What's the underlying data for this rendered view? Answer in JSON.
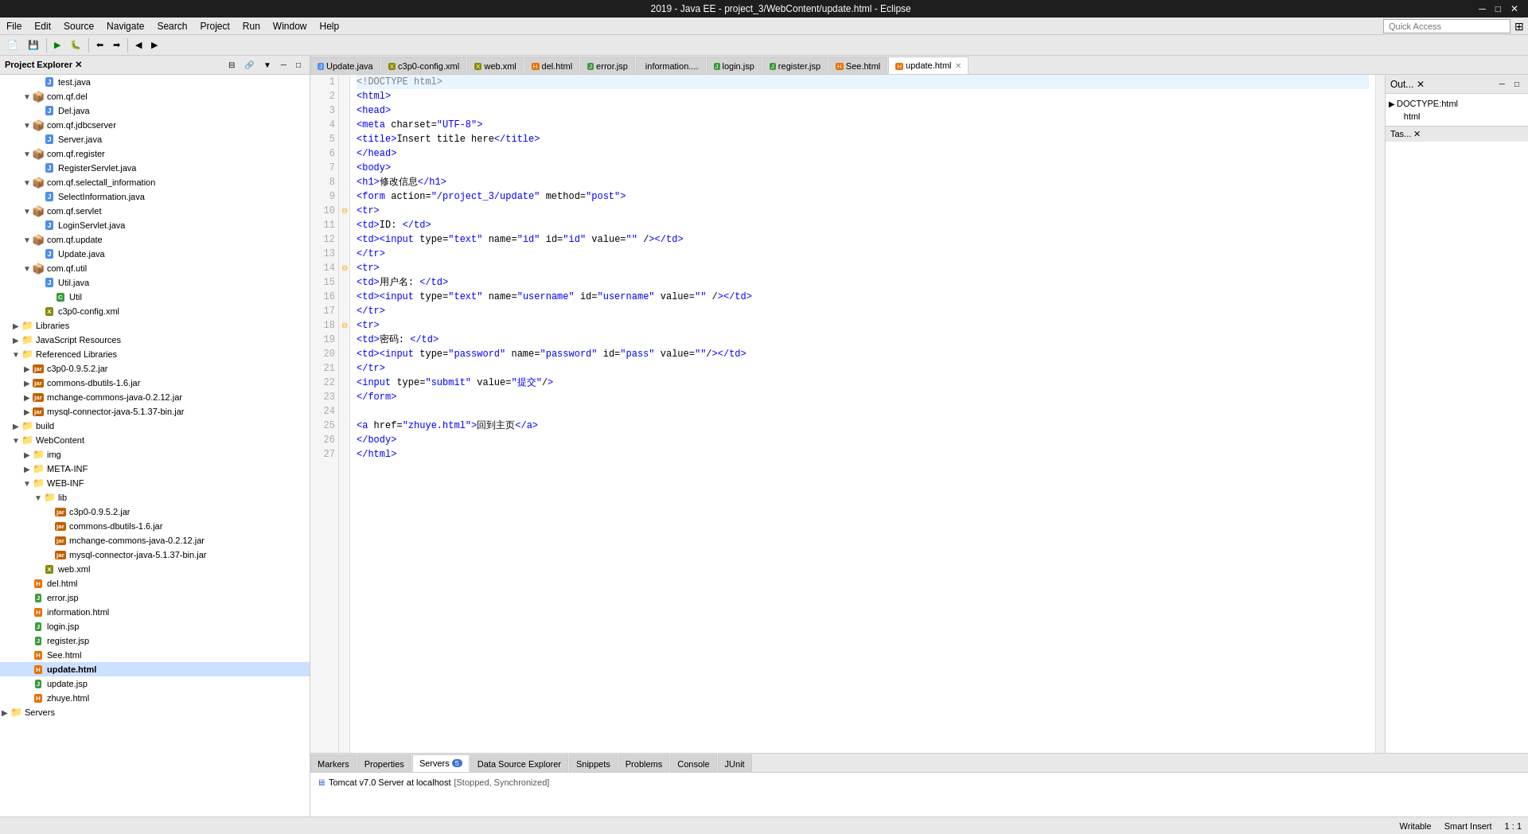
{
  "titlebar": {
    "title": "2019 - Java EE - project_3/WebContent/update.html - Eclipse",
    "controls": [
      "minimize",
      "maximize",
      "close"
    ]
  },
  "menubar": {
    "items": [
      "File",
      "Edit",
      "Source",
      "Navigate",
      "Search",
      "Project",
      "Run",
      "Window",
      "Help"
    ]
  },
  "tabs": {
    "items": [
      {
        "label": "Update.java",
        "icon": "J",
        "active": false,
        "closable": false
      },
      {
        "label": "c3p0-config.xml",
        "icon": "X",
        "active": false,
        "closable": false
      },
      {
        "label": "web.xml",
        "icon": "X",
        "active": false,
        "closable": false
      },
      {
        "label": "del.html",
        "icon": "H",
        "active": false,
        "closable": false
      },
      {
        "label": "error.jsp",
        "icon": "J",
        "active": false,
        "closable": false
      },
      {
        "label": "information....",
        "icon": "H",
        "active": false,
        "closable": false
      },
      {
        "label": "login.jsp",
        "icon": "J",
        "active": false,
        "closable": false
      },
      {
        "label": "register.jsp",
        "icon": "J",
        "active": false,
        "closable": false
      },
      {
        "label": "See.html",
        "icon": "H",
        "active": false,
        "closable": false
      },
      {
        "label": "update.html",
        "icon": "H",
        "active": true,
        "closable": true
      }
    ]
  },
  "editor": {
    "lines": [
      {
        "num": "1",
        "content": "<!DOCTYPE html>",
        "type": "doctype",
        "fold": false,
        "marker": false
      },
      {
        "num": "2",
        "content": "<html>",
        "type": "tag",
        "fold": false,
        "marker": false
      },
      {
        "num": "3",
        "content": "<head>",
        "type": "tag",
        "fold": false,
        "marker": false
      },
      {
        "num": "4",
        "content": "    <meta charset=\"UTF-8\">",
        "type": "tag",
        "fold": false,
        "marker": false
      },
      {
        "num": "5",
        "content": "    <title>Insert title here</title>",
        "type": "tag",
        "fold": false,
        "marker": false
      },
      {
        "num": "6",
        "content": "</head>",
        "type": "tag",
        "fold": false,
        "marker": false
      },
      {
        "num": "7",
        "content": "<body>",
        "type": "tag",
        "fold": false,
        "marker": false
      },
      {
        "num": "8",
        "content": "    <h1>修改信息</h1>",
        "type": "tag",
        "fold": false,
        "marker": false
      },
      {
        "num": "9",
        "content": "        <form action=\"/project_3/update\" method=\"post\">",
        "type": "tag",
        "fold": false,
        "marker": false
      },
      {
        "num": "10",
        "content": "            <tr>",
        "type": "tag",
        "fold": true,
        "marker": true
      },
      {
        "num": "11",
        "content": "                <td>ID: </td>",
        "type": "tag",
        "fold": false,
        "marker": false
      },
      {
        "num": "12",
        "content": "                <td><input type=\"text\" name=\"id\" id=\"id\" value=\"\" /></td>",
        "type": "tag",
        "fold": false,
        "marker": false
      },
      {
        "num": "13",
        "content": "            </tr>",
        "type": "tag",
        "fold": false,
        "marker": false
      },
      {
        "num": "14",
        "content": "            <tr>",
        "type": "tag",
        "fold": true,
        "marker": true
      },
      {
        "num": "15",
        "content": "                <td>用户名: </td>",
        "type": "tag",
        "fold": false,
        "marker": false
      },
      {
        "num": "16",
        "content": "                <td><input type=\"text\" name=\"username\" id=\"username\" value=\"\" /></td>",
        "type": "tag",
        "fold": false,
        "marker": false
      },
      {
        "num": "17",
        "content": "            </tr>",
        "type": "tag",
        "fold": false,
        "marker": false
      },
      {
        "num": "18",
        "content": "            <tr>",
        "type": "tag",
        "fold": true,
        "marker": true
      },
      {
        "num": "19",
        "content": "                <td>密码: </td>",
        "type": "tag",
        "fold": false,
        "marker": false
      },
      {
        "num": "20",
        "content": "                <td><input type=\"password\" name=\"password\" id=\"pass\" value=\"\"/> </td>",
        "type": "tag",
        "fold": false,
        "marker": false
      },
      {
        "num": "21",
        "content": "            </tr>",
        "type": "tag",
        "fold": false,
        "marker": false
      },
      {
        "num": "22",
        "content": "            <input type=\"submit\" value=\"提交\"/>",
        "type": "tag",
        "fold": false,
        "marker": false
      },
      {
        "num": "23",
        "content": "        </form>",
        "type": "tag",
        "fold": false,
        "marker": false
      },
      {
        "num": "24",
        "content": "",
        "type": "empty",
        "fold": false,
        "marker": false
      },
      {
        "num": "25",
        "content": "        <a href=\"zhuye.html\">回到主页</a>",
        "type": "tag",
        "fold": false,
        "marker": false
      },
      {
        "num": "26",
        "content": "</body>",
        "type": "tag",
        "fold": false,
        "marker": false
      },
      {
        "num": "27",
        "content": "</html>",
        "type": "tag",
        "fold": false,
        "marker": false
      }
    ]
  },
  "project_explorer": {
    "title": "Project Explorer",
    "tree": [
      {
        "id": "test",
        "label": "test.java",
        "level": 3,
        "type": "java",
        "arrow": "",
        "expanded": false
      },
      {
        "id": "com.qf.del",
        "label": "com.qf.del",
        "level": 2,
        "type": "package",
        "arrow": "▼",
        "expanded": true
      },
      {
        "id": "Del",
        "label": "Del.java",
        "level": 3,
        "type": "java",
        "arrow": "",
        "expanded": false
      },
      {
        "id": "com.qf.jdbcserver",
        "label": "com.qf.jdbcserver",
        "level": 2,
        "type": "package",
        "arrow": "▼",
        "expanded": true
      },
      {
        "id": "Server",
        "label": "Server.java",
        "level": 3,
        "type": "java",
        "arrow": "",
        "expanded": false
      },
      {
        "id": "com.qf.register",
        "label": "com.qf.register",
        "level": 2,
        "type": "package",
        "arrow": "▼",
        "expanded": true
      },
      {
        "id": "RegisterServlet",
        "label": "RegisterServlet.java",
        "level": 3,
        "type": "java",
        "arrow": "",
        "expanded": false
      },
      {
        "id": "com.qf.selectall_information",
        "label": "com.qf.selectall_information",
        "level": 2,
        "type": "package",
        "arrow": "▼",
        "expanded": true
      },
      {
        "id": "SelectInformation",
        "label": "SelectInformation.java",
        "level": 3,
        "type": "java",
        "arrow": "",
        "expanded": false
      },
      {
        "id": "com.qf.servlet",
        "label": "com.qf.servlet",
        "level": 2,
        "type": "package",
        "arrow": "▼",
        "expanded": true
      },
      {
        "id": "LoginServlet",
        "label": "LoginServlet.java",
        "level": 3,
        "type": "java",
        "arrow": "",
        "expanded": false
      },
      {
        "id": "com.qf.update",
        "label": "com.qf.update",
        "level": 2,
        "type": "package",
        "arrow": "▼",
        "expanded": true
      },
      {
        "id": "Update",
        "label": "Update.java",
        "level": 3,
        "type": "java",
        "arrow": "",
        "expanded": false
      },
      {
        "id": "com.qf.util",
        "label": "com.qf.util",
        "level": 2,
        "type": "package",
        "arrow": "▼",
        "expanded": true
      },
      {
        "id": "Util",
        "label": "Util.java",
        "level": 3,
        "type": "java",
        "arrow": "",
        "expanded": false
      },
      {
        "id": "UtilClass",
        "label": "Util",
        "level": 4,
        "type": "class",
        "arrow": "",
        "expanded": false
      },
      {
        "id": "c3p0-config",
        "label": "c3p0-config.xml",
        "level": 3,
        "type": "xml",
        "arrow": "",
        "expanded": false
      },
      {
        "id": "Libraries",
        "label": "Libraries",
        "level": 1,
        "type": "folder",
        "arrow": "▶",
        "expanded": false
      },
      {
        "id": "JsResources",
        "label": "JavaScript Resources",
        "level": 1,
        "type": "folder",
        "arrow": "▶",
        "expanded": false
      },
      {
        "id": "RefLibraries",
        "label": "Referenced Libraries",
        "level": 1,
        "type": "folder",
        "arrow": "▼",
        "expanded": true
      },
      {
        "id": "c3p0jar",
        "label": "c3p0-0.9.5.2.jar",
        "level": 2,
        "type": "jar",
        "arrow": "▶",
        "expanded": false
      },
      {
        "id": "commons-dbutils",
        "label": "commons-dbutils-1.6.jar",
        "level": 2,
        "type": "jar",
        "arrow": "▶",
        "expanded": false
      },
      {
        "id": "mchange-commons",
        "label": "mchange-commons-java-0.2.12.jar",
        "level": 2,
        "type": "jar",
        "arrow": "▶",
        "expanded": false
      },
      {
        "id": "mysql-connector",
        "label": "mysql-connector-java-5.1.37-bin.jar",
        "level": 2,
        "type": "jar",
        "arrow": "▶",
        "expanded": false
      },
      {
        "id": "build",
        "label": "build",
        "level": 1,
        "type": "folder",
        "arrow": "▶",
        "expanded": false
      },
      {
        "id": "WebContent",
        "label": "WebContent",
        "level": 1,
        "type": "folder",
        "arrow": "▼",
        "expanded": true
      },
      {
        "id": "img",
        "label": "img",
        "level": 2,
        "type": "folder",
        "arrow": "▶",
        "expanded": false
      },
      {
        "id": "META-INF",
        "label": "META-INF",
        "level": 2,
        "type": "folder",
        "arrow": "▶",
        "expanded": false
      },
      {
        "id": "WEB-INF",
        "label": "WEB-INF",
        "level": 2,
        "type": "folder",
        "arrow": "▼",
        "expanded": true
      },
      {
        "id": "lib",
        "label": "lib",
        "level": 3,
        "type": "folder",
        "arrow": "▼",
        "expanded": true
      },
      {
        "id": "c3p0jar2",
        "label": "c3p0-0.9.5.2.jar",
        "level": 4,
        "type": "jar",
        "arrow": "",
        "expanded": false
      },
      {
        "id": "commons-dbutils2",
        "label": "commons-dbutils-1.6.jar",
        "level": 4,
        "type": "jar",
        "arrow": "",
        "expanded": false
      },
      {
        "id": "mchange2",
        "label": "mchange-commons-java-0.2.12.jar",
        "level": 4,
        "type": "jar",
        "arrow": "",
        "expanded": false
      },
      {
        "id": "mysql2",
        "label": "mysql-connector-java-5.1.37-bin.jar",
        "level": 4,
        "type": "jar",
        "arrow": "",
        "expanded": false
      },
      {
        "id": "web.xml",
        "label": "web.xml",
        "level": 3,
        "type": "xml",
        "arrow": "",
        "expanded": false
      },
      {
        "id": "del.html",
        "label": "del.html",
        "level": 2,
        "type": "html",
        "arrow": "",
        "expanded": false
      },
      {
        "id": "error.jsp",
        "label": "error.jsp",
        "level": 2,
        "type": "jsp",
        "arrow": "",
        "expanded": false
      },
      {
        "id": "information.html",
        "label": "information.html",
        "level": 2,
        "type": "html",
        "arrow": "",
        "expanded": false
      },
      {
        "id": "login.jsp",
        "label": "login.jsp",
        "level": 2,
        "type": "jsp",
        "arrow": "",
        "expanded": false
      },
      {
        "id": "register.jsp",
        "label": "register.jsp",
        "level": 2,
        "type": "jsp",
        "arrow": "",
        "expanded": false
      },
      {
        "id": "See.html",
        "label": "See.html",
        "level": 2,
        "type": "html",
        "arrow": "",
        "expanded": false
      },
      {
        "id": "update.html",
        "label": "update.html",
        "level": 2,
        "type": "html",
        "arrow": "",
        "expanded": false,
        "selected": true
      },
      {
        "id": "update.jsp",
        "label": "update.jsp",
        "level": 2,
        "type": "jsp",
        "arrow": "",
        "expanded": false
      },
      {
        "id": "zhuye.html",
        "label": "zhuye.html",
        "level": 2,
        "type": "html",
        "arrow": "",
        "expanded": false
      },
      {
        "id": "Servers",
        "label": "Servers",
        "level": 0,
        "type": "folder",
        "arrow": "▶",
        "expanded": false
      }
    ]
  },
  "outline_panel": {
    "title": "Out...",
    "items": [
      {
        "label": "DOCTYPE:html",
        "level": 0,
        "arrow": "▶"
      },
      {
        "label": "html",
        "level": 1,
        "arrow": ""
      }
    ]
  },
  "bottom_panel": {
    "tabs": [
      {
        "label": "Markers",
        "active": false
      },
      {
        "label": "Properties",
        "active": false
      },
      {
        "label": "Servers",
        "active": true,
        "badge": "5"
      },
      {
        "label": "Data Source Explorer",
        "active": false
      },
      {
        "label": "Snippets",
        "active": false
      },
      {
        "label": "Problems",
        "active": false
      },
      {
        "label": "Console",
        "active": false
      },
      {
        "label": "JUnit",
        "active": false
      }
    ],
    "server_row": {
      "icon": "server",
      "label": "Tomcat v7.0 Server at localhost",
      "status": "[Stopped, Synchronized]"
    }
  },
  "statusbar": {
    "writable": "Writable",
    "insert_mode": "Smart Insert",
    "position": "1 : 1"
  }
}
